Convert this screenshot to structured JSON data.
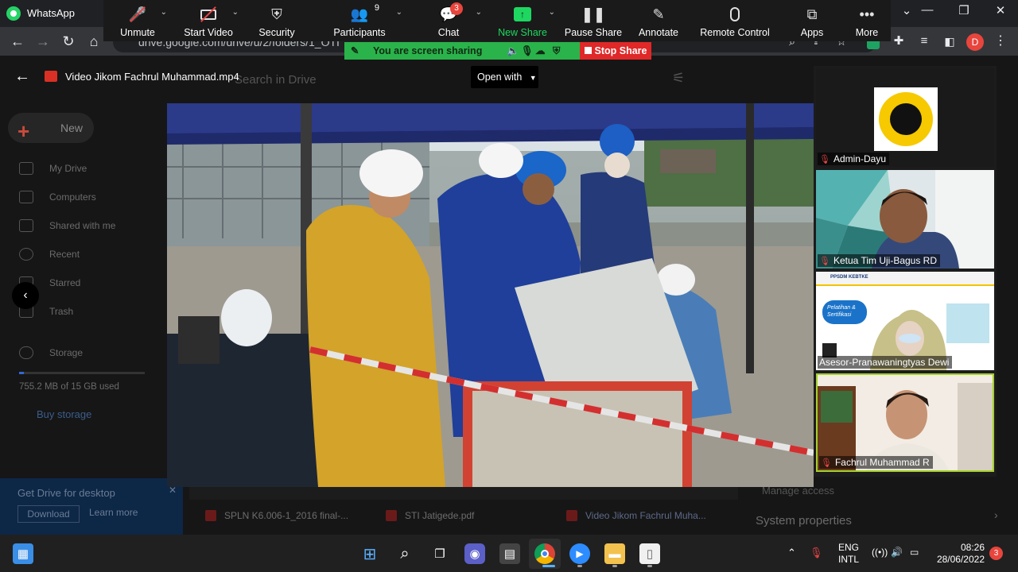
{
  "browser": {
    "tab_title": "WhatsApp",
    "url": "drive.google.com/drive/u/2/folders/1_OTI",
    "profile_initial": "D"
  },
  "zoom_toolbar": {
    "items": [
      {
        "label": "Unmute",
        "icon": "microphone-muted-icon"
      },
      {
        "label": "Start Video",
        "icon": "video-camera-off-icon"
      },
      {
        "label": "Security",
        "icon": "shield-icon"
      },
      {
        "label": "Participants",
        "icon": "participants-icon",
        "count": "9"
      },
      {
        "label": "Chat",
        "icon": "chat-bubble-icon",
        "badge": "3"
      },
      {
        "label": "New Share",
        "icon": "share-screen-icon"
      },
      {
        "label": "Pause Share",
        "icon": "pause-icon"
      },
      {
        "label": "Annotate",
        "icon": "pencil-icon"
      },
      {
        "label": "Remote Control",
        "icon": "mouse-icon"
      },
      {
        "label": "Apps",
        "icon": "apps-icon"
      },
      {
        "label": "More",
        "icon": "ellipsis-icon"
      }
    ],
    "sharing_status": "You are screen sharing",
    "stop_share_label": "Stop Share"
  },
  "drive": {
    "search_placeholder": "Search in Drive",
    "new_label": "New",
    "sidebar": [
      {
        "label": "My Drive",
        "icon": "drive-icon"
      },
      {
        "label": "Computers",
        "icon": "computer-icon"
      },
      {
        "label": "Shared with me",
        "icon": "people-icon"
      },
      {
        "label": "Recent",
        "icon": "clock-icon"
      },
      {
        "label": "Starred",
        "icon": "star-icon"
      },
      {
        "label": "Trash",
        "icon": "trash-icon"
      }
    ],
    "storage_label": "Storage",
    "storage_used": "755.2 MB of 15 GB used",
    "buy_storage": "Buy storage",
    "get_drive": "Get Drive for desktop",
    "download": "Download",
    "learn_more": "Learn more",
    "files": [
      "SPLN K6.006-1_2016 final-...",
      "STI Jatigede.pdf",
      "Video Jikom Fachrul Muha..."
    ],
    "details": {
      "manage_access": "Manage access",
      "system_properties": "System properties"
    }
  },
  "viewer": {
    "file_title": "Video Jikom Fachrul Muhammad.mp4",
    "open_with": "Open with"
  },
  "participants": [
    {
      "name": "Admin-Dayu"
    },
    {
      "name": "Ketua Tim Uji-Bagus RD"
    },
    {
      "name": "Asesor-Pranawaningtyas Dewi",
      "slide_text": "Pelatihan & Sertifikasi",
      "slide_header": "PPSDM KEBTKE"
    },
    {
      "name": "Fachrul Muhammad R"
    }
  ],
  "taskbar": {
    "language": "ENG",
    "layout": "INTL",
    "time": "08:26",
    "date": "28/06/2022",
    "notifications": "3"
  },
  "colors": {
    "zoom_green": "#1ed760",
    "stop_red": "#e02828",
    "active_speaker": "#a6d12b"
  }
}
